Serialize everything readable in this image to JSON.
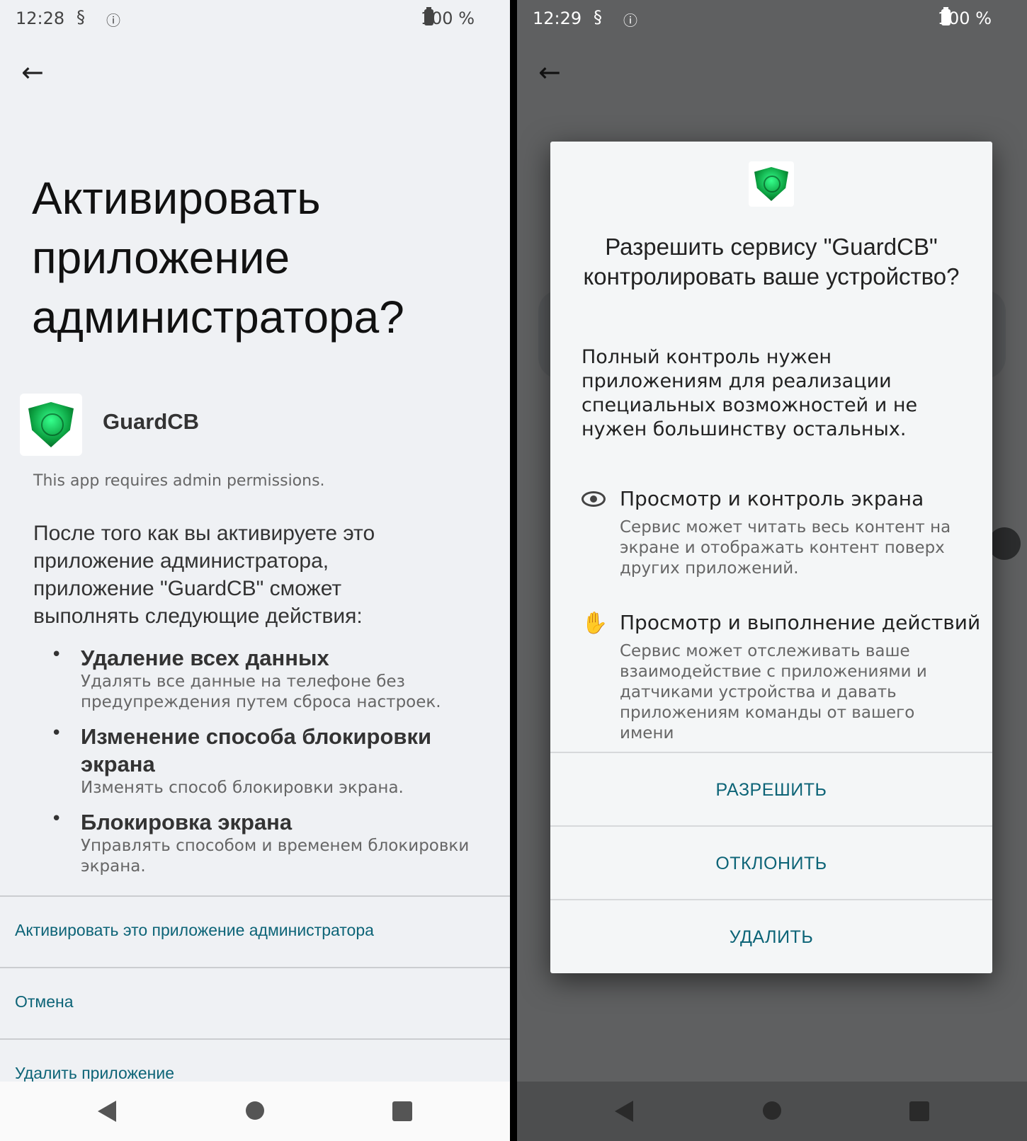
{
  "left": {
    "status": {
      "time": "12:28",
      "battery": "100 %"
    },
    "title": "Активировать приложение администратора?",
    "app_name": "GuardCB",
    "requires_text": "This app requires admin permissions.",
    "description": "После того как вы активируете это приложение администратора, приложение \"GuardCB\" сможет выполнять следующие действия:",
    "policies": [
      {
        "title": "Удаление всех данных",
        "desc": "Удалять все данные на телефоне без предупреждения путем сброса настроек."
      },
      {
        "title": "Изменение способа блокировки экрана",
        "desc": "Изменять способ блокировки экрана."
      },
      {
        "title": "Блокировка экрана",
        "desc": "Управлять способом и временем блокировки экрана."
      }
    ],
    "actions": {
      "activate": "Активировать это приложение администратора",
      "cancel": "Отмена",
      "uninstall": "Удалить приложение"
    }
  },
  "right": {
    "status": {
      "time": "12:29",
      "battery": "100 %"
    },
    "dialog": {
      "title": "Разрешить сервису \"GuardCB\" контролировать ваше устройство?",
      "body": "Полный контроль нужен приложениям для реализации специальных возможностей и не нужен большинству остальных.",
      "permissions": [
        {
          "icon": "eye-icon",
          "title": "Просмотр и контроль экрана",
          "desc": "Сервис может читать весь контент на экране и отображать контент поверх других приложений."
        },
        {
          "icon": "hand-icon",
          "title": "Просмотр и выполнение действий",
          "desc": "Сервис может отслеживать ваше взаимодействие с приложениями и датчиками устройства и давать приложениям команды от вашего имени"
        }
      ],
      "buttons": {
        "allow": "РАЗРЕШИТЬ",
        "deny": "ОТКЛОНИТЬ",
        "uninstall": "УДАЛИТЬ"
      }
    }
  },
  "colors": {
    "accent": "#0d6477",
    "light_bg": "#eff1f4",
    "scrim": "#5f6061"
  }
}
